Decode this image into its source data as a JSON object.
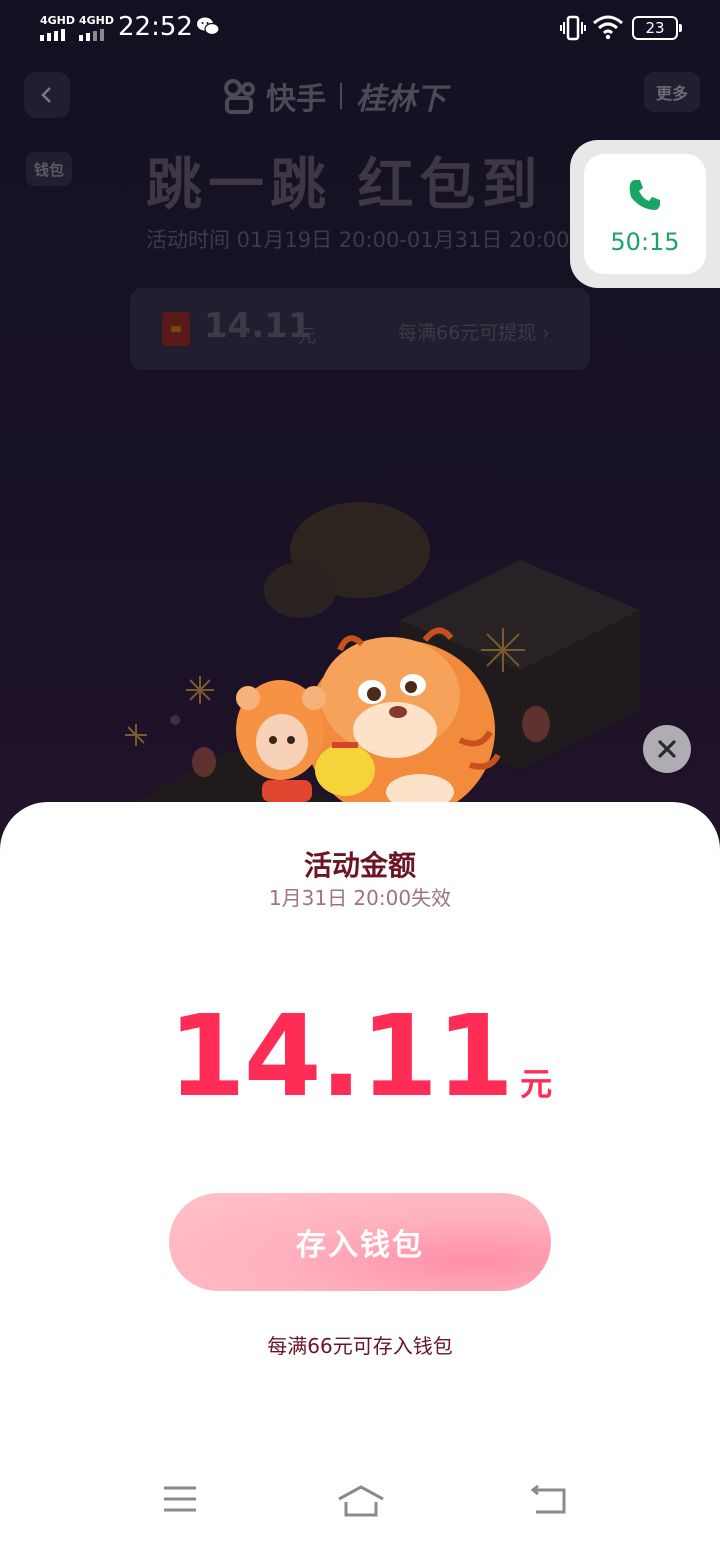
{
  "status_bar": {
    "sim1": "4GHD",
    "sim2": "4GHD",
    "time": "22:52",
    "battery": "23"
  },
  "activity_page": {
    "brand_left": "快手",
    "brand_right": "桂林下",
    "more_label": "更多",
    "wallet_label": "钱包",
    "title": "跳一跳 红包到",
    "period": "活动时间 01月19日 20:00-01月31日 20:00",
    "card_amount": "14.11",
    "card_unit": "元",
    "card_hint": "每满66元可提现 ›"
  },
  "call_float": {
    "duration": "50:15",
    "icon": "phone-icon",
    "accent": "#1aa564"
  },
  "sheet": {
    "title": "活动金额",
    "expiry": "1月31日 20:00失效",
    "amount": "14.11",
    "unit": "元",
    "deposit_button": "存入钱包",
    "note": "每满66元可存入钱包",
    "amount_color": "#ff2d55"
  },
  "nav_bar": {
    "icons": [
      "menu-icon",
      "home-icon",
      "back-icon"
    ]
  }
}
